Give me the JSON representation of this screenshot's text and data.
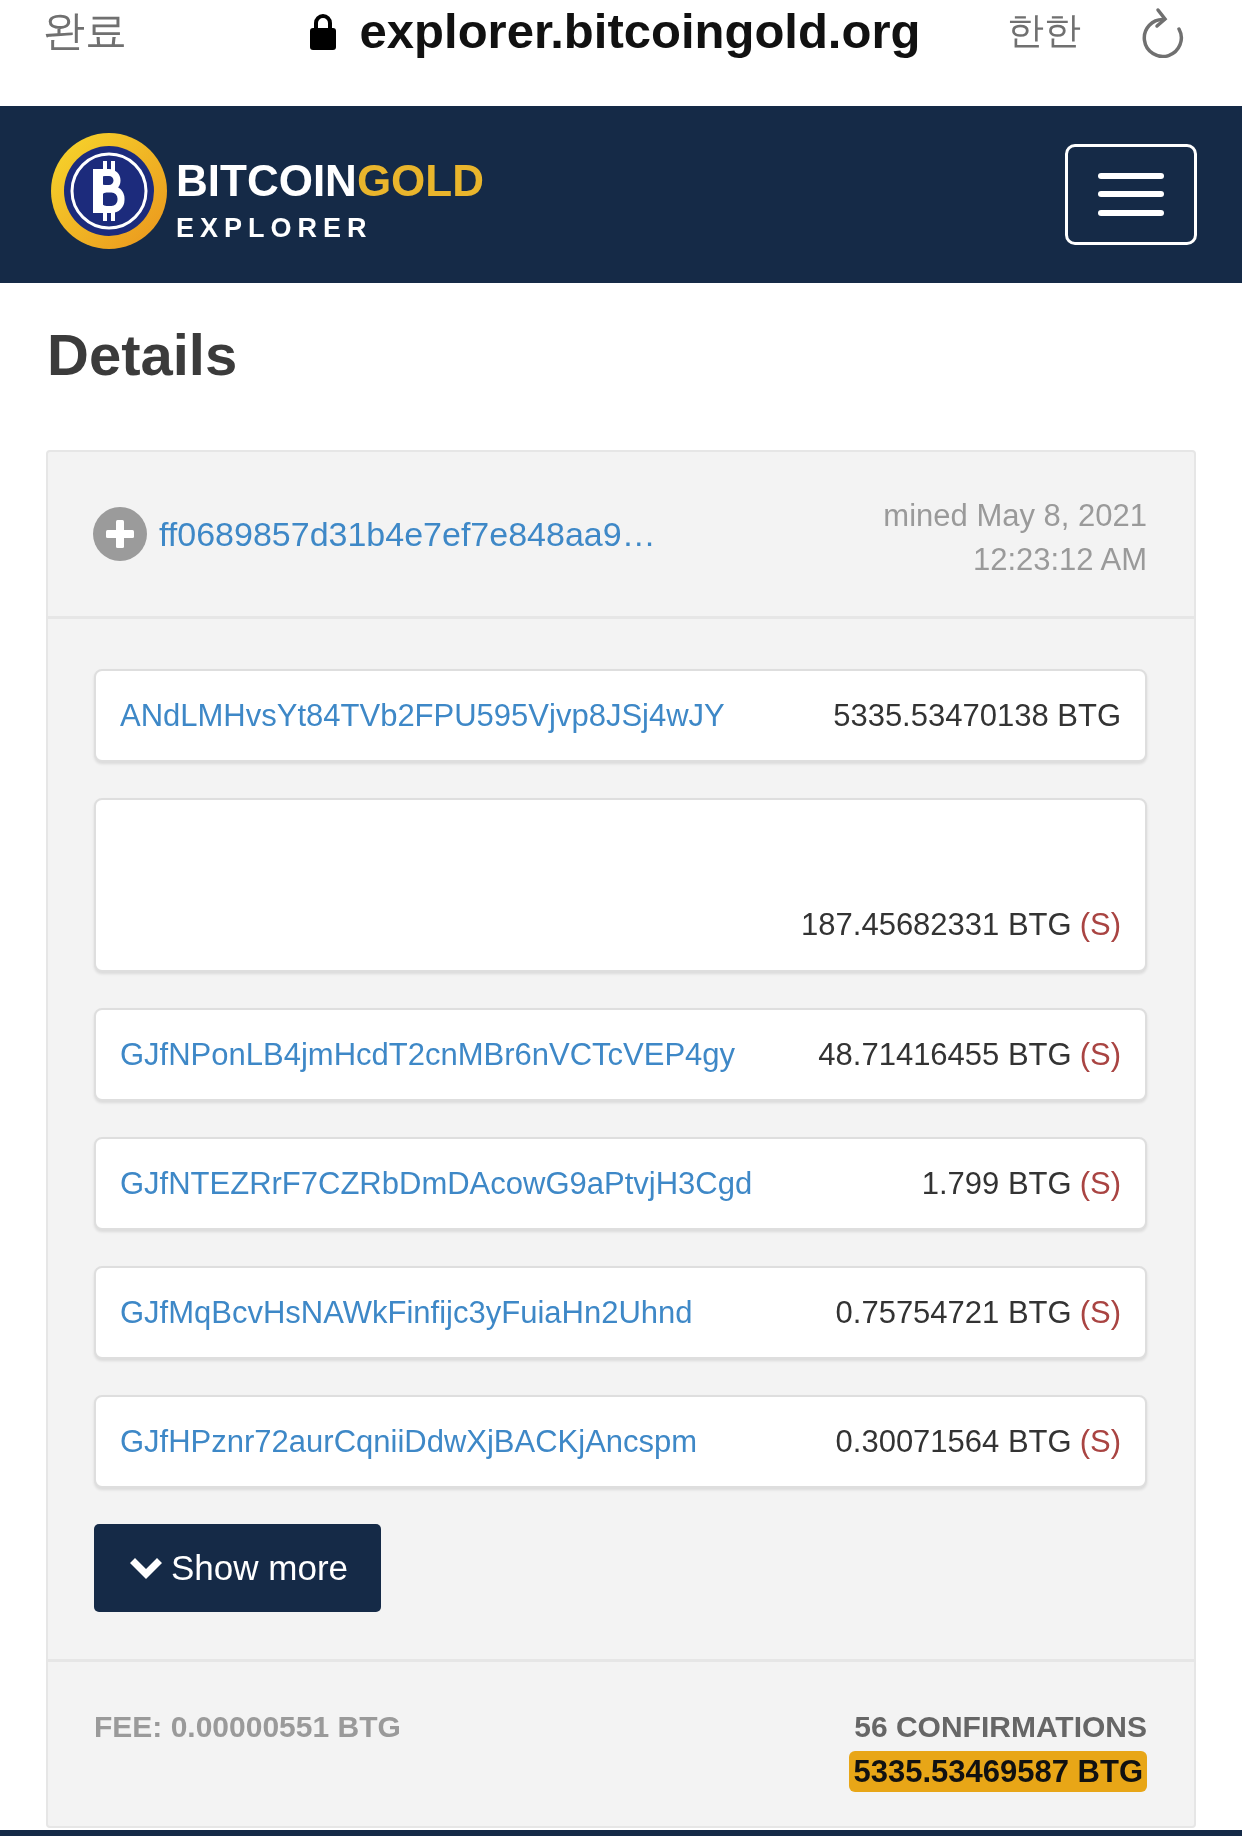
{
  "browser_bar": {
    "done": "완료",
    "url": "explorer.bitcoingold.org",
    "text_size": "한한"
  },
  "navbar": {
    "brand_first": "BITCOIN",
    "brand_second": "GOLD",
    "brand_subtitle": "EXPLORER"
  },
  "heading": "Details",
  "transaction": {
    "hash": "ff0689857d31b4e7ef7e848aa9…",
    "mined_date": "mined May 8, 2021",
    "mined_time": "12:23:12 AM",
    "outputs": [
      {
        "address": "ANdLMHvsYt84TVb2FPU595Vjvp8JSj4wJY",
        "amount": "5335.53470138 BTG"
      },
      {
        "amount": "187.45682331 BTG",
        "marker": "(S)"
      },
      {
        "address": "GJfNPonLB4jmHcdT2cnMBr6nVCTcVEP4gy",
        "amount": "48.71416455 BTG",
        "marker": "(S)"
      },
      {
        "address": "GJfNTEZRrF7CZRbDmDAcowG9aPtvjH3Cgd",
        "amount": "1.799 BTG",
        "marker": "(S)"
      },
      {
        "address": "GJfMqBcvHsNAWkFinfijc3yFuiaHn2Uhnd",
        "amount": "0.75754721 BTG",
        "marker": "(S)"
      },
      {
        "address": "GJfHPznr72aurCqniiDdwXjBACKjAncspm",
        "amount": "0.30071564 BTG",
        "marker": "(S)"
      }
    ],
    "show_more": "Show more",
    "fee": "FEE: 0.00000551 BTG",
    "confirmations": "56 CONFIRMATIONS",
    "total": "5335.53469587 BTG"
  }
}
